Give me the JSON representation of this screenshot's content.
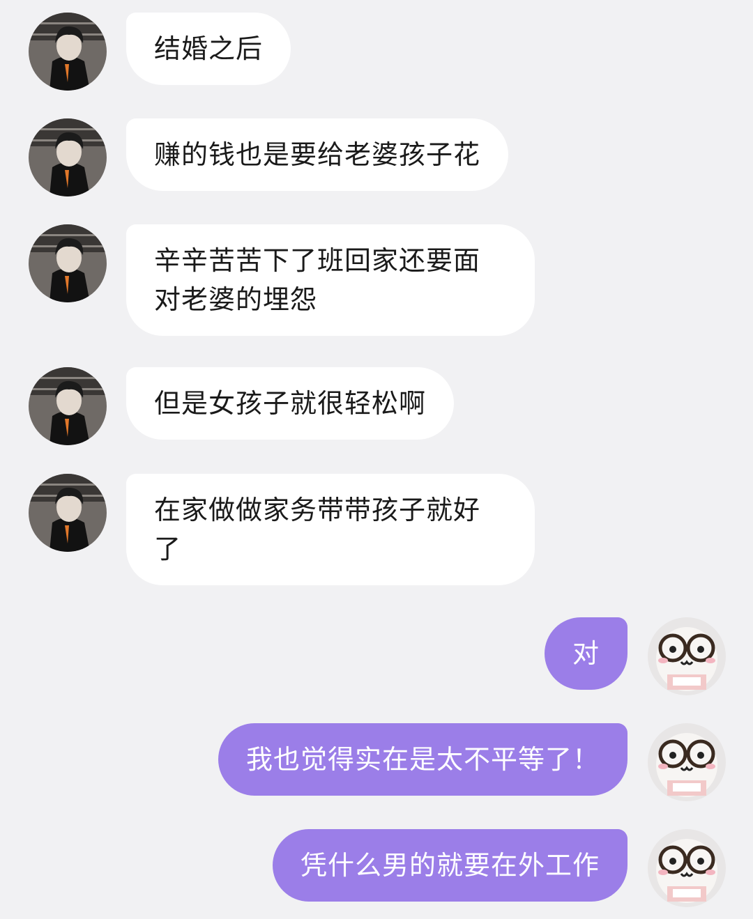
{
  "theme": {
    "background": "#f1f1f3",
    "incoming_bubble": "#ffffff",
    "outgoing_bubble": "#9b7ee8",
    "incoming_text": "#1a1a1a",
    "outgoing_text": "#ffffff"
  },
  "messages": [
    {
      "side": "left",
      "avatar": "avatar-dark-jacket-person",
      "text": "结婚之后"
    },
    {
      "side": "left",
      "avatar": "avatar-dark-jacket-person",
      "text": "赚的钱也是要给老婆孩子花"
    },
    {
      "side": "left",
      "avatar": "avatar-dark-jacket-person",
      "text": "辛辛苦苦下了班回家还要面对老婆的埋怨"
    },
    {
      "side": "left",
      "avatar": "avatar-dark-jacket-person",
      "text": "但是女孩子就很轻松啊"
    },
    {
      "side": "left",
      "avatar": "avatar-dark-jacket-person",
      "text": "在家做做家务带带孩子就好了"
    },
    {
      "side": "right",
      "avatar": "avatar-glasses-plush-toy",
      "text": "对"
    },
    {
      "side": "right",
      "avatar": "avatar-glasses-plush-toy",
      "text": "我也觉得实在是太不平等了！"
    },
    {
      "side": "right",
      "avatar": "avatar-glasses-plush-toy",
      "text": "凭什么男的就要在外工作"
    }
  ]
}
